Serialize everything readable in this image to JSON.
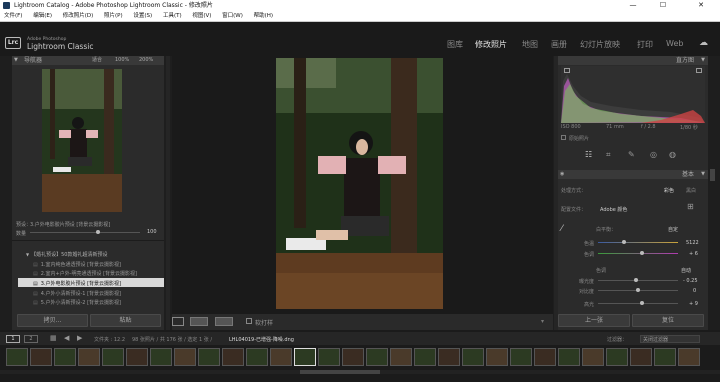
{
  "window": {
    "title": "Lightroom Catalog - Adobe Photoshop Lightroom Classic - 修改照片",
    "minimize": "—",
    "maximize": "☐",
    "close": "✕"
  },
  "menu": [
    "文件(F)",
    "编辑(E)",
    "修改照片(D)",
    "照片(P)",
    "设置(S)",
    "工具(T)",
    "视图(V)",
    "窗口(W)",
    "帮助(H)"
  ],
  "brand": {
    "badge": "Lrc",
    "line1": "Adobe Photoshop",
    "line2": "Lightroom Classic"
  },
  "modules": [
    "图库",
    "修改照片",
    "地图",
    "画册",
    "幻灯片放映",
    "打印",
    "Web"
  ],
  "active_module": "修改照片",
  "navigator": {
    "title": "导航器",
    "fit": "适合",
    "z1": "100%",
    "z2": "200%"
  },
  "preview": {
    "label": "预设：",
    "name": "3.户外电影胶片预设 [背景云摄影视]",
    "amount_label": "数量",
    "amount": "100"
  },
  "presets": {
    "group": "【婚礼预设】50款婚礼超清新预设",
    "items": [
      "1.室内纯色通透预设 [背景云摄影视]",
      "2.室内+户外-明亮通透预设 [背景云摄影视]",
      "3.户外电影胶片预设 [背景云摄影视]",
      "4.户外小清新预设-1 [背景云摄影视]",
      "5.户外小清新预设-2 [背景云摄影视]"
    ],
    "selected_index": 2
  },
  "left_buttons": {
    "copy": "拷贝...",
    "paste": "粘贴"
  },
  "toolbar": {
    "soft_proof": "软打样"
  },
  "histogram": {
    "title": "直方图",
    "iso": "ISO 800",
    "focal": "71 mm",
    "aperture": "f / 2.8",
    "shutter": "1/80 秒",
    "orig": "原始照片"
  },
  "basic": {
    "title": "基本",
    "treatment_label": "处理方式：",
    "color": "彩色",
    "bw": "黑白",
    "profile_label": "配置文件：",
    "profile_value": "Adobe 颜色",
    "wb_label": "白平衡：",
    "wb_value": "自定",
    "temp_label": "色温",
    "temp_value": "5122",
    "tint_label": "色调",
    "tint_value": "+ 6",
    "tone_label": "色调",
    "auto": "自动",
    "exposure_label": "曝光度",
    "exposure_value": "- 0.25",
    "contrast_label": "对比度",
    "contrast_value": "0",
    "highlights_label": "高光",
    "highlights_value": "+ 9"
  },
  "right_buttons": {
    "prev": "上一张",
    "reset": "复位"
  },
  "filmstrip_bar": {
    "page1": "1",
    "page2": "2",
    "source": "文件夹 : 12.2",
    "count": "98 张照片 / 共 176 张 / 选定 1 张 /",
    "filename": "LHL04019-已增强-降噪.dng",
    "filter_label": "过滤器：",
    "filter_value": "关闭过滤器"
  },
  "colors": {
    "accent": "#e6e6e6",
    "panel": "#2b2b2b",
    "header": "#393939",
    "bg": "#1e1e1e"
  }
}
